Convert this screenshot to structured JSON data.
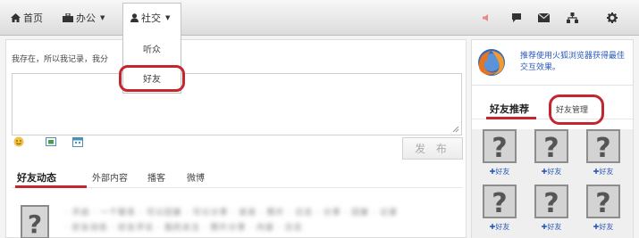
{
  "nav": {
    "home": "首页",
    "office": "办公",
    "social": "社交"
  },
  "dropdown": {
    "items": [
      "听众",
      "好友"
    ]
  },
  "composer": {
    "prompt": "我存在，所以我记录，我分",
    "publish_label": "发 布"
  },
  "feed_tabs": [
    "好友动态",
    "外部内容",
    "播客",
    "微博"
  ],
  "feed": {
    "blurred_line_1": "· 开启 · 一个联系 · 可以回复 · 可以分享 · 说说 · 照片 · 日志 · 分享 · 回复 · 记录",
    "blurred_line_2": "· 好友动态 · 好友评论 · 我的关注 · 照片分享 · 内容 · 日志"
  },
  "sidebar": {
    "promo_text": "推荐使用火狐浏览器获得最佳交互效果。",
    "tabs": [
      "好友推荐",
      "好友管理"
    ],
    "friends": [
      "好友",
      "好友",
      "好友",
      "好友",
      "好友",
      "好友"
    ],
    "add_prefix": "✚"
  },
  "colors": {
    "accent_red": "#c2262e",
    "link_blue": "#2a5ab8"
  }
}
